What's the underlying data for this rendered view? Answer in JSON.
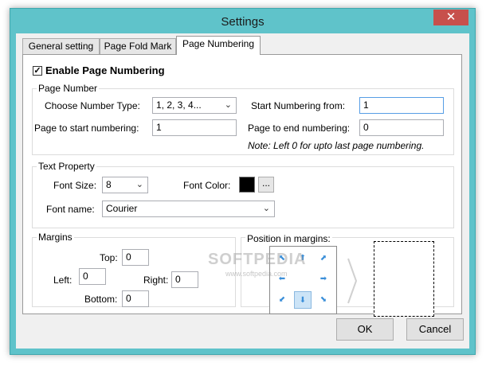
{
  "window": {
    "title": "Settings",
    "close_glyph": "✕"
  },
  "tabs": [
    {
      "label": "General setting",
      "active": false
    },
    {
      "label": "Page Fold Mark",
      "active": false
    },
    {
      "label": "Page Numbering",
      "active": true
    }
  ],
  "enable": {
    "label": "Enable Page Numbering",
    "checked": true,
    "check_glyph": "✓"
  },
  "page_number": {
    "group_title": "Page Number",
    "number_type_label": "Choose Number Type:",
    "number_type_value": "1, 2, 3, 4...",
    "start_from_label": "Start Numbering from:",
    "start_from_value": "1",
    "page_start_label": "Page to start numbering:",
    "page_start_value": "1",
    "page_end_label": "Page to end numbering:",
    "page_end_value": "0",
    "note": "Note: Left 0 for upto last page numbering."
  },
  "text_property": {
    "group_title": "Text Property",
    "font_size_label": "Font Size:",
    "font_size_value": "8",
    "font_color_label": "Font Color:",
    "font_color": "#000000",
    "font_color_button": "...",
    "font_name_label": "Font name:",
    "font_name_value": "Courier"
  },
  "margins": {
    "group_title": "Margins",
    "top_label": "Top:",
    "top_value": "0",
    "left_label": "Left:",
    "left_value": "0",
    "right_label": "Right:",
    "right_value": "0",
    "bottom_label": "Bottom:",
    "bottom_value": "0"
  },
  "position": {
    "label": "Position in margins:",
    "selected": "bottom-center",
    "arrows": {
      "top_left": "⬉",
      "top_center": "⬆",
      "top_right": "⬈",
      "middle_left": "⬅",
      "middle_right": "➡",
      "bottom_left": "⬋",
      "bottom_center": "⬇",
      "bottom_right": "⬊"
    }
  },
  "buttons": {
    "ok": "OK",
    "cancel": "Cancel"
  },
  "chevron_glyph": "⌄",
  "watermark": {
    "main": "SOFTPEDIA",
    "sub": "www.softpedia.com"
  }
}
